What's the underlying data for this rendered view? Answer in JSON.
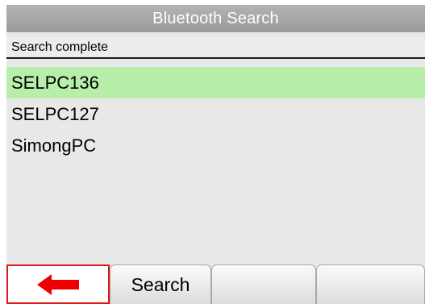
{
  "header": {
    "title": "Bluetooth Search"
  },
  "status": {
    "text": "Search complete"
  },
  "devices": [
    {
      "name": "SELPC136",
      "selected": true
    },
    {
      "name": "SELPC127",
      "selected": false
    },
    {
      "name": "SimongPC",
      "selected": false
    }
  ],
  "softkeys": {
    "back_icon": "left-arrow-icon",
    "search_label": "Search",
    "key3_label": "",
    "key4_label": ""
  },
  "colors": {
    "selected_row": "#b7eeaa",
    "back_key_border": "#e01616",
    "arrow": "#ee0000"
  }
}
